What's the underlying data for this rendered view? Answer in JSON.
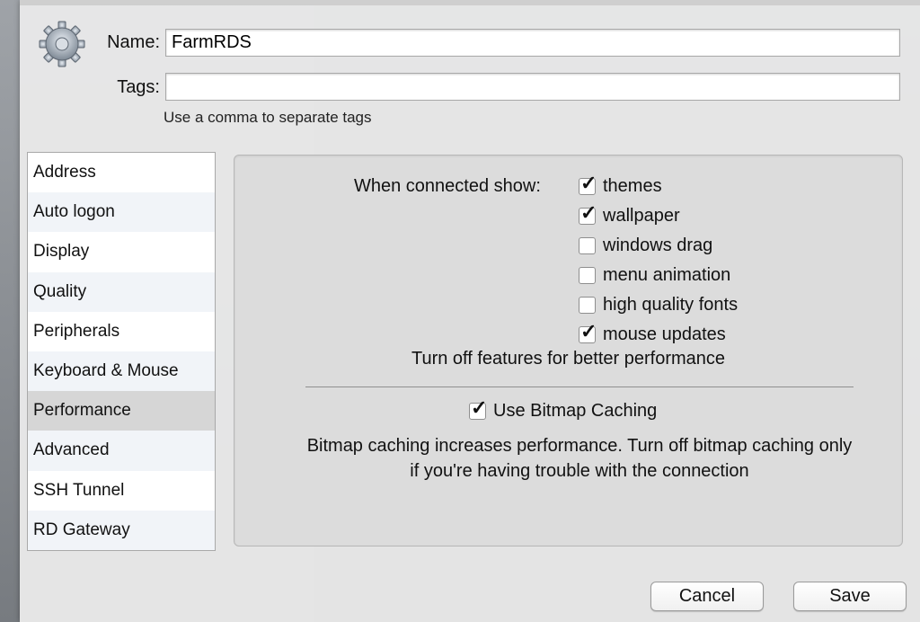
{
  "header": {
    "name_label": "Name:",
    "name_value": "FarmRDS",
    "tags_label": "Tags:",
    "tags_value": "",
    "tags_hint": "Use a comma to separate tags",
    "icon": "gear-icon"
  },
  "sidebar": {
    "items": [
      {
        "label": "Address",
        "selected": false
      },
      {
        "label": "Auto logon",
        "selected": false
      },
      {
        "label": "Display",
        "selected": false
      },
      {
        "label": "Quality",
        "selected": false
      },
      {
        "label": "Peripherals",
        "selected": false
      },
      {
        "label": "Keyboard & Mouse",
        "selected": false
      },
      {
        "label": "Performance",
        "selected": true
      },
      {
        "label": "Advanced",
        "selected": false
      },
      {
        "label": "SSH Tunnel",
        "selected": false
      },
      {
        "label": "RD Gateway",
        "selected": false
      }
    ]
  },
  "performance": {
    "show_label": "When connected show:",
    "options": [
      {
        "label": "themes",
        "checked": true
      },
      {
        "label": "wallpaper",
        "checked": true
      },
      {
        "label": "windows drag",
        "checked": false
      },
      {
        "label": "menu animation",
        "checked": false
      },
      {
        "label": "high quality fonts",
        "checked": false
      },
      {
        "label": "mouse updates",
        "checked": true
      }
    ],
    "performance_note": "Turn off features for better performance",
    "bitmap_caching": {
      "label": "Use Bitmap Caching",
      "checked": true
    },
    "bitmap_note": "Bitmap caching increases performance. Turn off bitmap caching only if you're having trouble with the connection"
  },
  "buttons": {
    "cancel_label": "Cancel",
    "save_label": "Save"
  },
  "check_glyph": "✓"
}
